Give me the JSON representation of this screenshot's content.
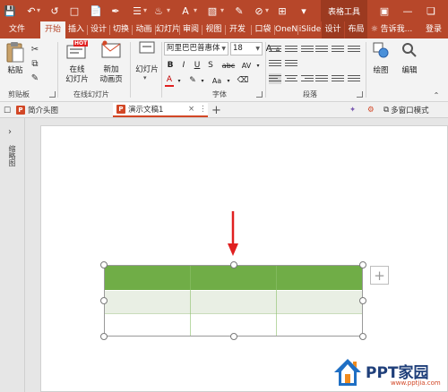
{
  "titlebar": {
    "context_tab_label": "表格工具",
    "login_label": "登录"
  },
  "tabs": [
    {
      "label": "文件"
    },
    {
      "label": "开始"
    },
    {
      "label": "插入"
    },
    {
      "label": "设计"
    },
    {
      "label": "切换"
    },
    {
      "label": "动画"
    },
    {
      "label": "幻灯片"
    },
    {
      "label": "审阅"
    },
    {
      "label": "视图"
    },
    {
      "label": "开发"
    },
    {
      "label": "口袋"
    },
    {
      "label": "OneN"
    },
    {
      "label": "iSlide"
    },
    {
      "label": "设计"
    },
    {
      "label": "布局"
    }
  ],
  "tell_me": "告诉我...",
  "ribbon": {
    "paste_label": "粘贴",
    "clipboard_group": "剪贴板",
    "online_slide_label_1": "在线",
    "online_slide_label_2": "幻灯片",
    "new_anim_label_1": "新加",
    "new_anim_label_2": "动画页",
    "online_slides_group": "在线幻灯片",
    "slide_btn_label": "幻灯片",
    "font_name": "阿里巴巴普惠体",
    "font_size": "18",
    "font_group": "字体",
    "paragraph_group": "段落",
    "drawing_label": "绘图",
    "editing_label": "编辑",
    "hot_badge": "HOT",
    "bold": "B",
    "italic": "I",
    "underline": "U",
    "strike": "S",
    "abc": "abc",
    "av": "AV",
    "aa": "Aa",
    "font_color_letter": "A",
    "font_grow": "A",
    "font_shrink": "A"
  },
  "doc_tabs": {
    "tab1": "简介头图",
    "tab2": "演示文稿1",
    "multi_window": "多窗口模式"
  },
  "left_pane": {
    "label": "缩略图"
  },
  "watermark": {
    "text": "PPT家园",
    "sub": "www.pptjia.com"
  },
  "colors": {
    "accent": "#b7472a",
    "table_header": "#70ad47",
    "table_band": "#e9efe4",
    "arrow": "#e02020"
  }
}
